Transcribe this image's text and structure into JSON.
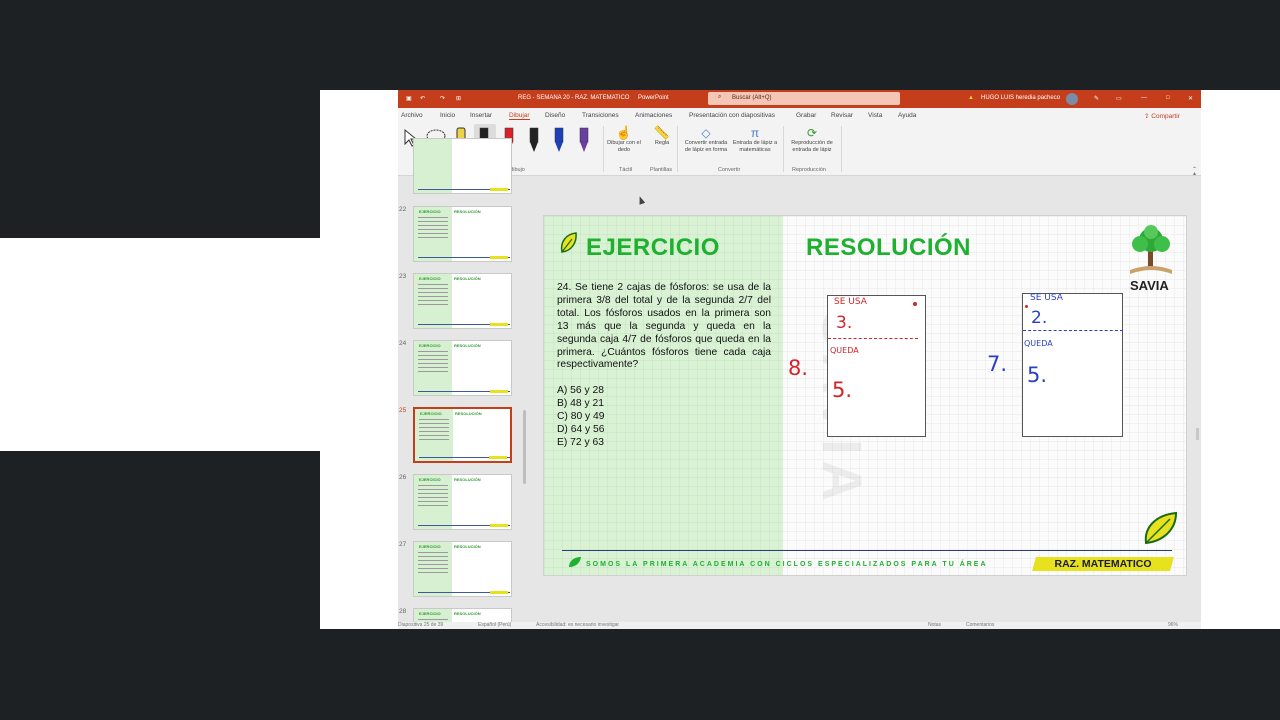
{
  "window": {
    "title": "REG - SEMANA 20 - RAZ. MATEMATICO",
    "app_name": "PowerPoint",
    "search_placeholder": "Buscar (Alt+Q)",
    "user": "HUGO LUIS heredia pacheco",
    "accent_color": "#c43e1c"
  },
  "menu": {
    "tabs": [
      "Archivo",
      "Inicio",
      "Insertar",
      "Dibujar",
      "Diseño",
      "Transiciones",
      "Animaciones",
      "Presentación con diapositivas",
      "Grabar",
      "Revisar",
      "Vista",
      "Ayuda"
    ],
    "active_tab": "Dibujar",
    "share_label": "Compartir"
  },
  "ribbon": {
    "group_drawing_tools": "Herramientas de dibujo",
    "btn_draw_finger": "Dibujar con el dedo",
    "btn_ruler": "Regla",
    "group_touch": "Táctil",
    "group_templates": "Plantillas",
    "btn_ink_to_shape": "Convertir entrada de lápiz en forma",
    "btn_ink_to_math": "Entrada de lápiz a matemáticas",
    "group_convert": "Convertir",
    "btn_ink_replay": "Reproducción de entrada de lápiz",
    "group_replay": "Reproducción",
    "pen_colors": [
      "#222222",
      "#d8222a",
      "#222222",
      "#1f3fb8",
      "#6a3fa0",
      "#1fae3c"
    ]
  },
  "thumbnails": [
    {
      "num": "22",
      "left_title": "EJERCICIO",
      "right_title": "RESOLUCIÓN"
    },
    {
      "num": "23",
      "left_title": "EJERCICIO",
      "right_title": "RESOLUCIÓN"
    },
    {
      "num": "24",
      "left_title": "EJERCICIO",
      "right_title": "RESOLUCIÓN"
    },
    {
      "num": "25",
      "left_title": "EJERCICIO",
      "right_title": "RESOLUCIÓN"
    },
    {
      "num": "26",
      "left_title": "EJERCICIO",
      "right_title": "RESOLUCIÓN"
    },
    {
      "num": "27",
      "left_title": "EJERCICIO",
      "right_title": "RESOLUCIÓN"
    },
    {
      "num": "28",
      "left_title": "EJERCICIO",
      "right_title": "RESOLUCIÓN"
    }
  ],
  "selected_slide": "25",
  "slide": {
    "left_title": "EJERCICIO",
    "right_title": "RESOLUCIÓN",
    "problem": "24. Se tiene 2 cajas de fósforos: se usa de la primera 3/8 del total y de la segunda 2/7 del total. Los fósforos usados en la primera son 13 más que la segunda y queda en la segunda caja 4/7 de fósforos que queda en la primera. ¿Cuántos fósforos tiene cada caja respectivamente?",
    "options": [
      "A) 56 y 28",
      "B) 48 y 21",
      "C) 80 y 49",
      "D) 64 y 56",
      "E) 72 y 63"
    ],
    "brand": "SAVIA",
    "footer_text": "SOMOS LA PRIMERA ACADEMIA CON CICLOS ESPECIALIZADOS PARA TU ÁREA",
    "footer_badge": "RAZ. MATEMATICO",
    "ink": {
      "box1": {
        "outside": "8.",
        "top_label": "SE USA",
        "top_value": "3.",
        "bottom_label": "QUEDA",
        "bottom_value": "5.",
        "color": "#d8222a"
      },
      "box2": {
        "outside": "7.",
        "top_label": "SE USA",
        "top_value": "2.",
        "bottom_label": "QUEDA",
        "bottom_value": "5.",
        "color": "#2a3fc8"
      }
    }
  },
  "status": {
    "slide_info": "Diapositiva 25 de 39",
    "language": "Español (Perú)",
    "accessibility": "Accesibilidad: es necesario investigar",
    "notes": "Notas",
    "comments": "Comentarios",
    "zoom": "96%"
  }
}
